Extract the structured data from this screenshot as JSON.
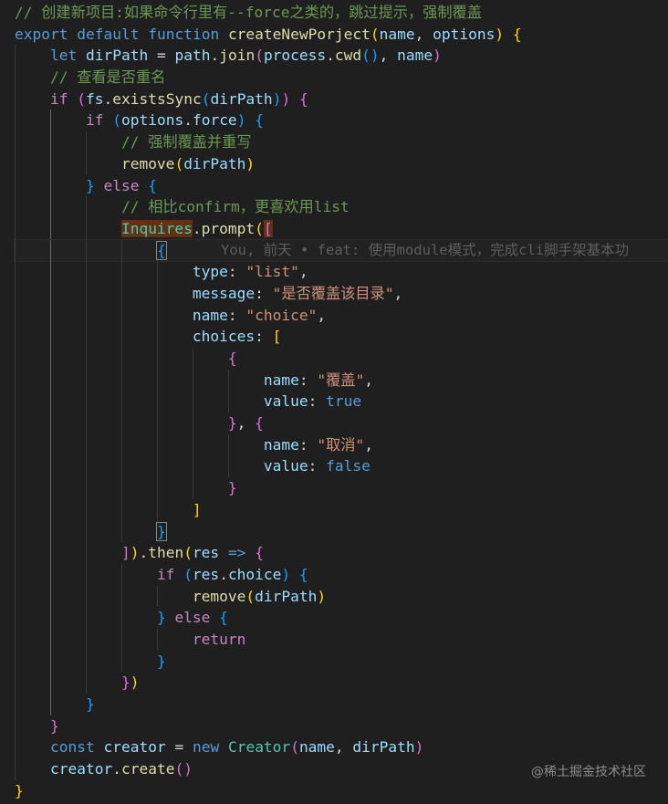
{
  "code": {
    "l1": {
      "comment": "// 创建新项目:如果命令行里有--force之类的，跳过提示，强制覆盖"
    },
    "l2": {
      "kw1": "export",
      "kw2": "default",
      "kw3": "function",
      "fn": "createNewPorject",
      "p1": "name",
      "p2": "options"
    },
    "l3": {
      "kw": "let",
      "var": "dirPath",
      "obj": "path",
      "fn": "join",
      "obj2": "process",
      "fn2": "cwd",
      "arg": "name"
    },
    "l4": {
      "comment": "// 查看是否重名"
    },
    "l5": {
      "kw": "if",
      "obj": "fs",
      "fn": "existsSync",
      "arg": "dirPath"
    },
    "l6": {
      "kw": "if",
      "obj": "options",
      "prop": "force"
    },
    "l7": {
      "comment": "// 强制覆盖并重写"
    },
    "l8": {
      "fn": "remove",
      "arg": "dirPath"
    },
    "l9": {
      "kw": "else"
    },
    "l10": {
      "comment": "// 相比confirm，更喜欢用list"
    },
    "l11": {
      "obj": "Inquires",
      "fn": "prompt"
    },
    "l12": {
      "blame": "You, 前天 • feat: 使用module模式，完成cli脚手架基本功"
    },
    "l13": {
      "key": "type",
      "val": "\"list\""
    },
    "l14": {
      "key": "message",
      "val": "\"是否覆盖该目录\""
    },
    "l15": {
      "key": "name",
      "val": "\"choice\""
    },
    "l16": {
      "key": "choices"
    },
    "l18": {
      "key": "name",
      "val": "\"覆盖\""
    },
    "l19": {
      "key": "value",
      "val": "true"
    },
    "l21": {
      "key": "name",
      "val": "\"取消\""
    },
    "l22": {
      "key": "value",
      "val": "false"
    },
    "l25": {
      "fn": "then",
      "param": "res"
    },
    "l26": {
      "kw": "if",
      "obj": "res",
      "prop": "choice"
    },
    "l27": {
      "fn": "remove",
      "arg": "dirPath"
    },
    "l28": {
      "kw": "else"
    },
    "l29": {
      "kw": "return"
    },
    "l34": {
      "kw": "const",
      "var": "creator",
      "kw2": "new",
      "cls": "Creator",
      "a1": "name",
      "a2": "dirPath"
    },
    "l35": {
      "obj": "creator",
      "fn": "create"
    }
  },
  "watermark": "@稀土掘金技术社区",
  "colors": {
    "background": "#1f1f1f",
    "keyword": "#569cd6",
    "control": "#c586c0",
    "function": "#dcdcaa",
    "variable": "#9cdcfe",
    "string": "#ce9178",
    "comment": "#6a9955",
    "class": "#4ec9b0",
    "bracket_gold": "#ffd700",
    "bracket_orchid": "#da70d6",
    "bracket_blue": "#179fff"
  }
}
